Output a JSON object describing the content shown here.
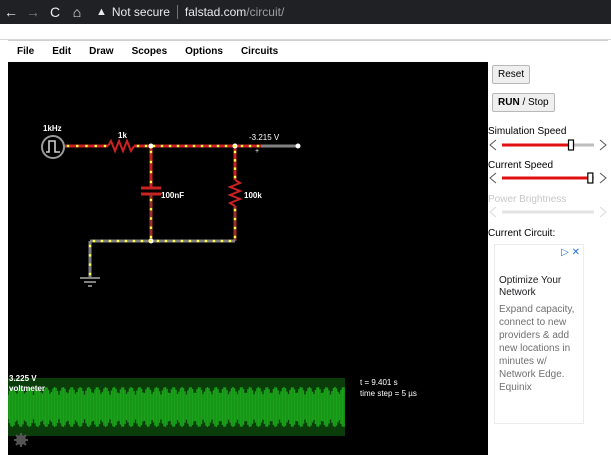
{
  "browser": {
    "back": "←",
    "forward": "→",
    "reload": "C",
    "home": "⌂",
    "warning": "▲",
    "not_secure": "Not secure",
    "domain": "falstad.com",
    "path": "/circuit/"
  },
  "menu": [
    "File",
    "Edit",
    "Draw",
    "Scopes",
    "Options",
    "Circuits"
  ],
  "circuit": {
    "source_label": "1kHz",
    "resistor1_label": "1k",
    "capacitor_label": "100nF",
    "resistor2_label": "100k",
    "output_voltage": "-3.215 V",
    "output_plus": "+"
  },
  "scope": {
    "voltage": "3.225 V",
    "name": "voltmeter",
    "time": "t = 9.401 s",
    "time_step": "time step = 5 µs"
  },
  "panel": {
    "reset": "Reset",
    "run": "RUN",
    "stop": " / Stop",
    "sim_speed_label": "Simulation Speed",
    "sim_speed_value": 0.75,
    "current_speed_label": "Current Speed",
    "current_speed_value": 0.96,
    "power_label": "Power Brightness",
    "current_circuit_label": "Current Circuit:"
  },
  "ad": {
    "icons": "▷ ✕",
    "title": "Optimize Your Network",
    "body": "Expand capacity, connect to new providers & add new locations in minutes w/ Network Edge. Equinix"
  },
  "colors": {
    "wire_red": "#cc2222",
    "wire_gray": "#808080",
    "dot_yellow": "#ffff44",
    "scope_green": "#1aa31a",
    "slider_red": "#e01010",
    "slider_gray": "#bdbdbd"
  }
}
